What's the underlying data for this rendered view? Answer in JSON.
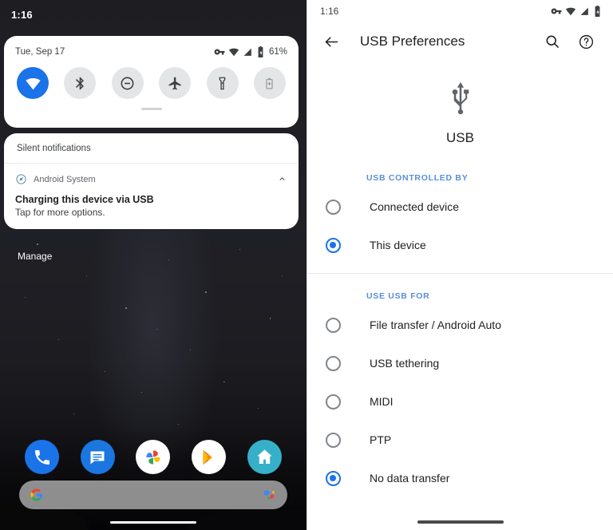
{
  "left_phone": {
    "status_bar": {
      "clock": "1:16",
      "icons": [
        "vpn-key-icon",
        "wifi-icon",
        "signal-icon",
        "battery-icon"
      ]
    },
    "quick_settings": {
      "date": "Tue, Sep 17",
      "battery_percent": "61%",
      "status_icons": [
        "vpn-key-icon",
        "wifi-icon",
        "signal-icon",
        "battery-icon"
      ],
      "tiles": [
        {
          "name": "wifi-tile",
          "icon": "wifi-icon",
          "state": "on"
        },
        {
          "name": "bluetooth-tile",
          "icon": "bluetooth-icon",
          "state": "off"
        },
        {
          "name": "do-not-disturb-tile",
          "icon": "do-not-disturb-icon",
          "state": "off"
        },
        {
          "name": "airplane-mode-tile",
          "icon": "airplane-icon",
          "state": "off"
        },
        {
          "name": "flashlight-tile",
          "icon": "flashlight-icon",
          "state": "off"
        },
        {
          "name": "battery-saver-tile",
          "icon": "battery-saver-icon",
          "state": "disabled"
        }
      ]
    },
    "notifications": {
      "section_header": "Silent notifications",
      "items": [
        {
          "app_name": "Android System",
          "app_icon": "android-system-icon",
          "title": "Charging this device via USB",
          "subtitle": "Tap for more options.",
          "collapse_icon": "chevron-up-icon"
        }
      ],
      "manage_label": "Manage"
    },
    "dock": [
      {
        "name": "phone-app-icon",
        "label": "Phone"
      },
      {
        "name": "messages-app-icon",
        "label": "Messages"
      },
      {
        "name": "photos-app-icon",
        "label": "Photos"
      },
      {
        "name": "play-store-app-icon",
        "label": "Play Store"
      },
      {
        "name": "home-app-icon",
        "label": "Home"
      }
    ],
    "search_bar": {
      "placeholder": "",
      "left_icon": "google-g-icon",
      "right_icon": "google-assistant-icon"
    }
  },
  "right_phone": {
    "status_bar": {
      "clock": "1:16",
      "icons": [
        "vpn-key-icon",
        "wifi-icon",
        "signal-icon",
        "battery-icon"
      ]
    },
    "app_bar": {
      "back_icon": "arrow-back-icon",
      "title": "USB Preferences",
      "search_icon": "search-icon",
      "help_icon": "help-icon"
    },
    "hero": {
      "icon": "usb-icon",
      "label": "USB"
    },
    "sections": [
      {
        "label": "USB CONTROLLED BY",
        "options": [
          {
            "label": "Connected device",
            "selected": false
          },
          {
            "label": "This device",
            "selected": true
          }
        ]
      },
      {
        "label": "USE USB FOR",
        "options": [
          {
            "label": "File transfer / Android Auto",
            "selected": false
          },
          {
            "label": "USB tethering",
            "selected": false
          },
          {
            "label": "MIDI",
            "selected": false
          },
          {
            "label": "PTP",
            "selected": false
          },
          {
            "label": "No data transfer",
            "selected": true
          }
        ]
      }
    ]
  },
  "colors": {
    "accent_blue": "#1a73e8",
    "section_label_blue": "#5a8fd8",
    "tile_off": "#e4e5e6",
    "text_primary": "#202124",
    "text_secondary": "#5f6368"
  }
}
